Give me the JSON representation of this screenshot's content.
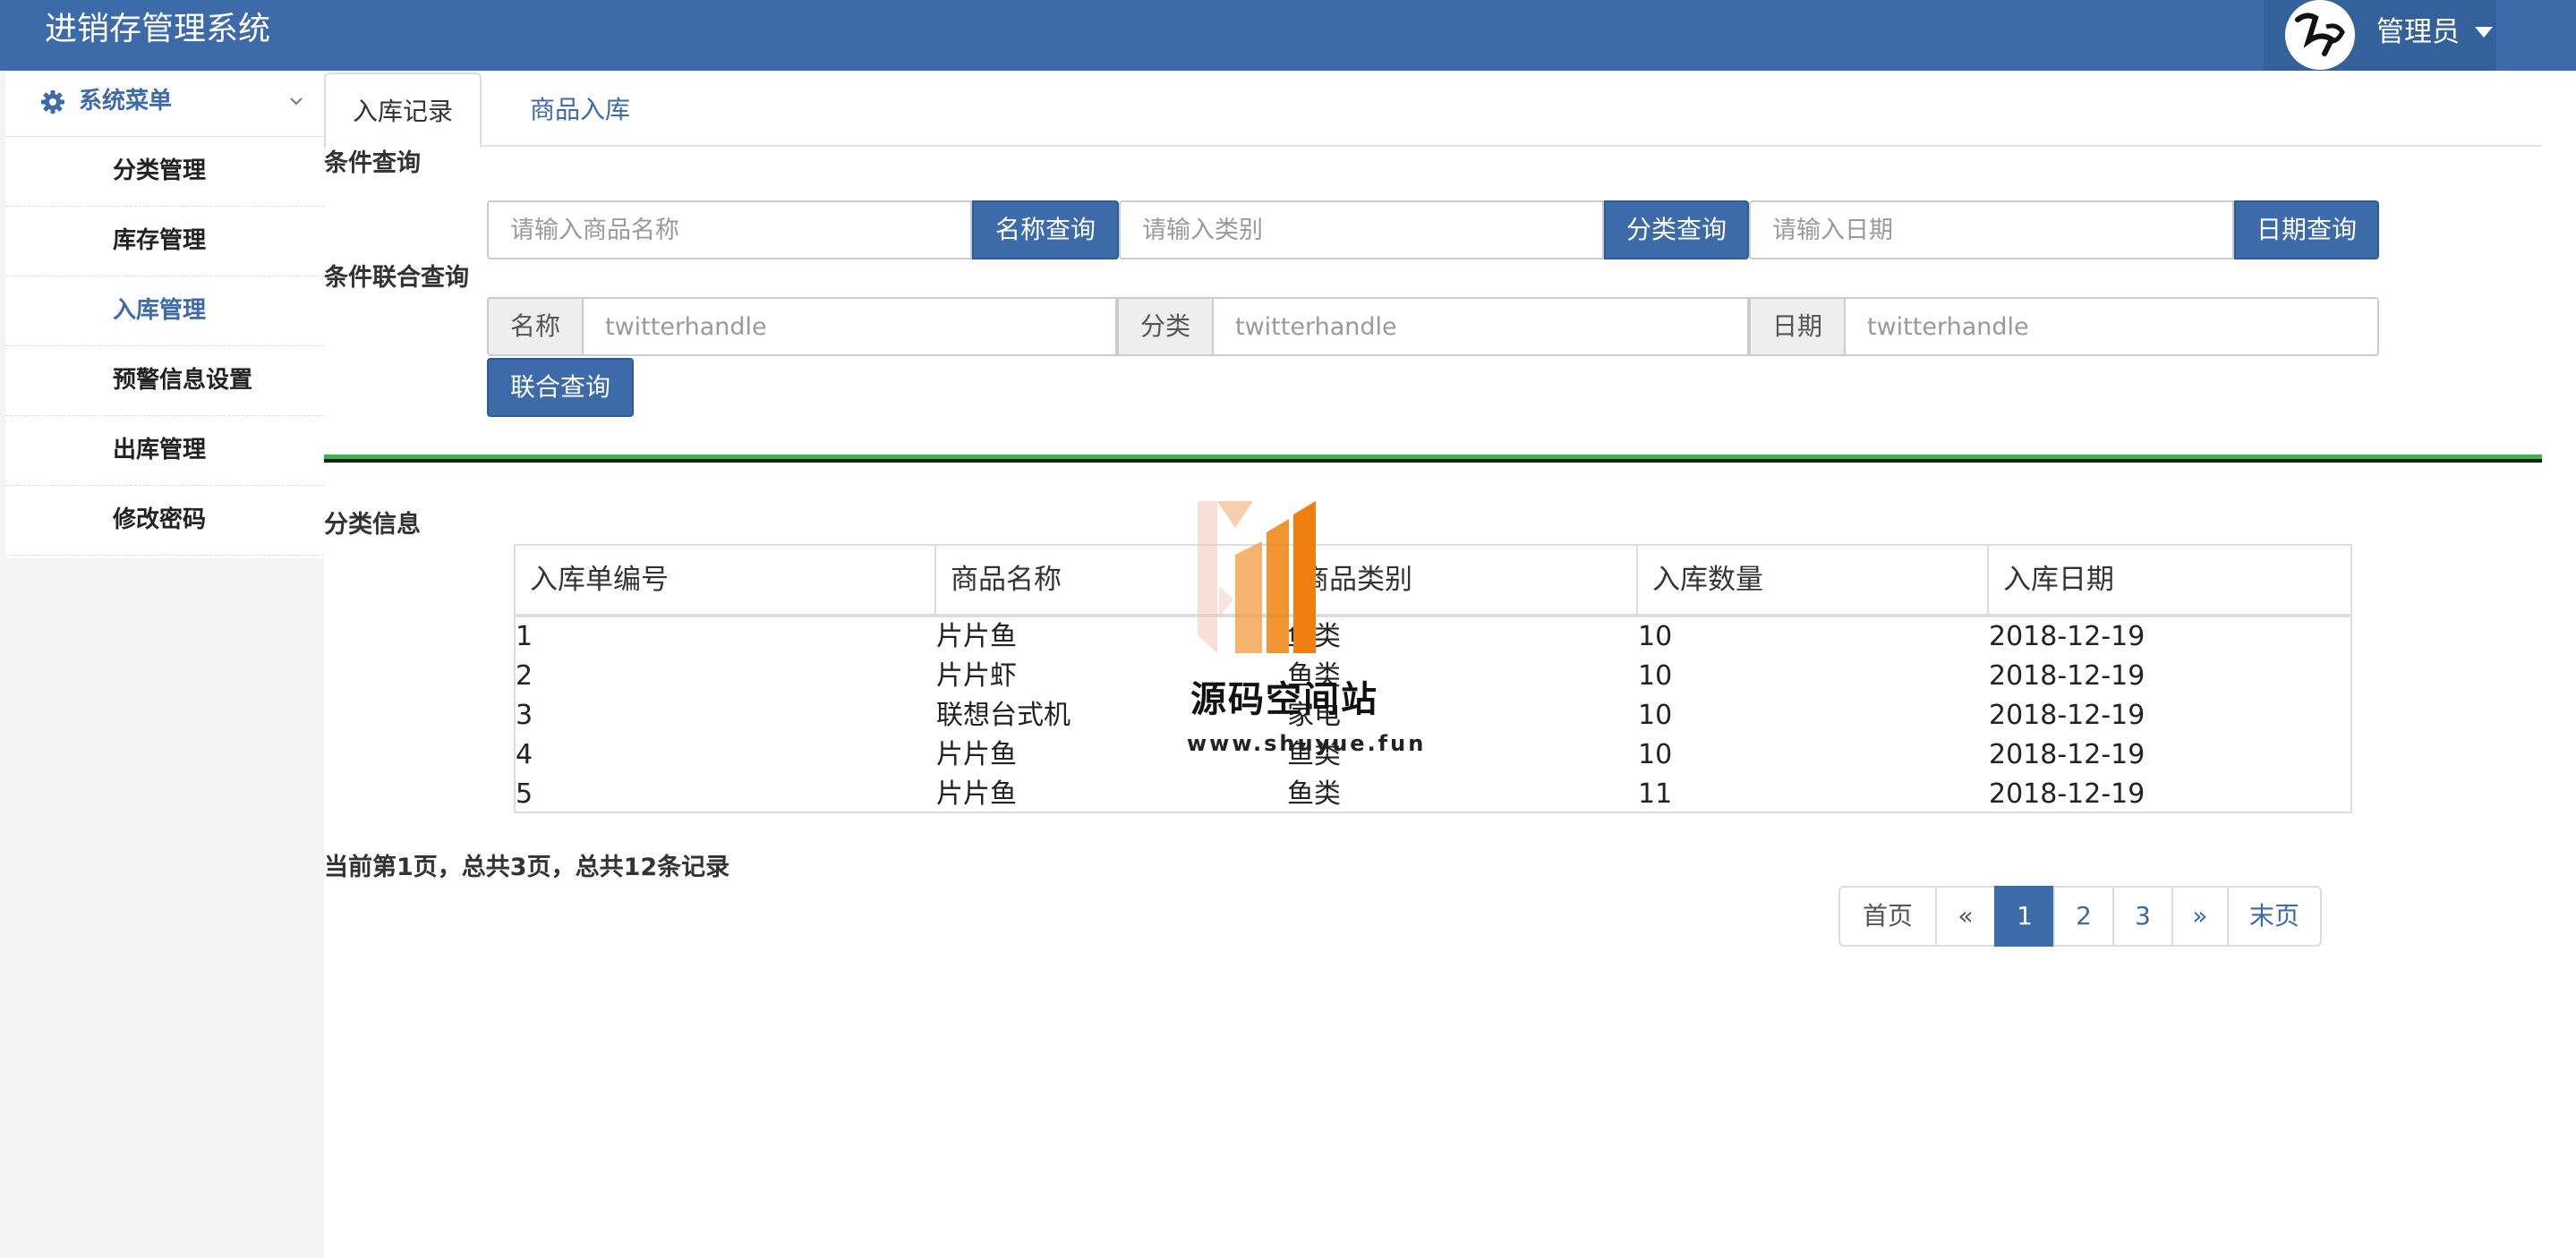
{
  "header": {
    "app_title": "进销存管理系统",
    "user_name": "管理员"
  },
  "sidebar": {
    "menu_title": "系统菜单",
    "items": [
      {
        "label": "分类管理",
        "active": false
      },
      {
        "label": "库存管理",
        "active": false
      },
      {
        "label": "入库管理",
        "active": true
      },
      {
        "label": "预警信息设置",
        "active": false
      },
      {
        "label": "出库管理",
        "active": false
      },
      {
        "label": "修改密码",
        "active": false
      }
    ]
  },
  "tabs": [
    {
      "label": "入库记录",
      "active": true
    },
    {
      "label": "商品入库",
      "active": false
    }
  ],
  "condition_query": {
    "label": "条件查询",
    "name_placeholder": "请输入商品名称",
    "name_button": "名称查询",
    "category_placeholder": "请输入类别",
    "category_button": "分类查询",
    "date_placeholder": "请输入日期",
    "date_button": "日期查询"
  },
  "combined_query": {
    "label": "条件联合查询",
    "name_addon": "名称",
    "name_placeholder": "twitterhandle",
    "category_addon": "分类",
    "category_placeholder": "twitterhandle",
    "date_addon": "日期",
    "date_placeholder": "twitterhandle",
    "button": "联合查询"
  },
  "table_section": {
    "label": "分类信息",
    "columns": [
      "入库单编号",
      "商品名称",
      "商品类别",
      "入库数量",
      "入库日期"
    ],
    "rows": [
      [
        "1",
        "片片鱼",
        "鱼类",
        "10",
        "2018-12-19"
      ],
      [
        "2",
        "片片虾",
        "鱼类",
        "10",
        "2018-12-19"
      ],
      [
        "3",
        "联想台式机",
        "家电",
        "10",
        "2018-12-19"
      ],
      [
        "4",
        "片片鱼",
        "鱼类",
        "10",
        "2018-12-19"
      ],
      [
        "5",
        "片片鱼",
        "鱼类",
        "11",
        "2018-12-19"
      ]
    ]
  },
  "summary": "当前第1页，总共3页，总共12条记录",
  "pagination": {
    "first": "首页",
    "prev": "«",
    "pages": [
      "1",
      "2",
      "3"
    ],
    "current": "1",
    "next": "»",
    "last": "末页"
  },
  "watermark": {
    "name": "源码空间站",
    "url": "www.shuyue.fun"
  },
  "colors": {
    "header": "#3d6aa8",
    "accent": "#3d6aa8",
    "divider_green": "#3cb64a"
  }
}
